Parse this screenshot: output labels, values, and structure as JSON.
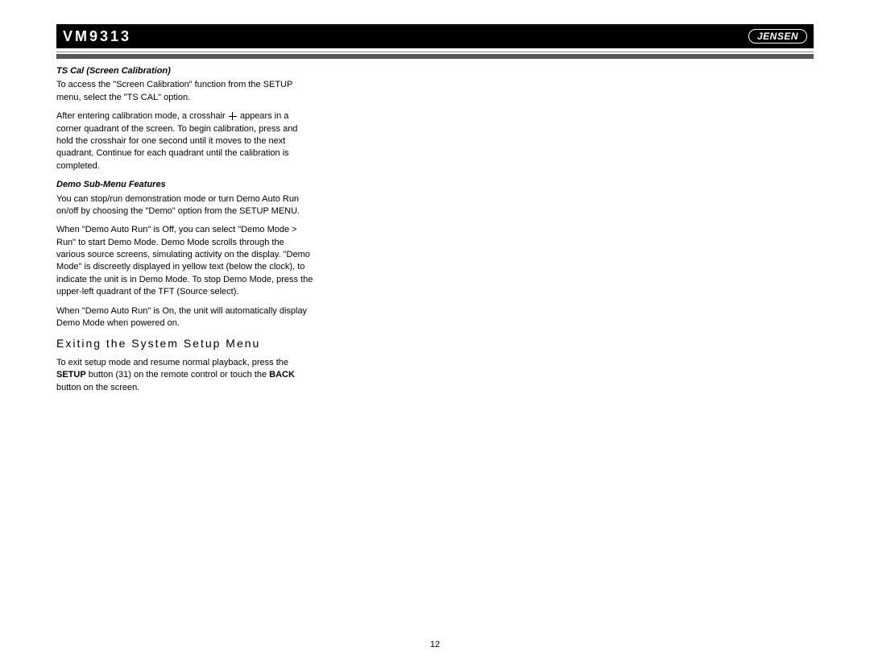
{
  "header": {
    "model": "VM9313",
    "brand": "JENSEN"
  },
  "content": {
    "section1": {
      "title": "TS Cal (Screen Calibration)",
      "p1": "To access the \"Screen Calibration\" function from the SETUP menu, select the \"TS CAL\" option.",
      "p2a": "After entering calibration mode, a crosshair ",
      "p2b": " appears in a corner quadrant of the screen. To begin calibration, press and hold the crosshair for one second until it moves to the next quadrant. Continue for each quadrant until the calibration is completed."
    },
    "section2": {
      "title": "Demo Sub-Menu Features",
      "p1": "You can stop/run demonstration mode or turn Demo Auto Run on/off by choosing the \"Demo\" option from the SETUP MENU.",
      "p2": "When \"Demo Auto Run\" is Off, you can select \"Demo Mode > Run\" to start Demo Mode. Demo Mode scrolls through the various source screens, simulating activity on the display. \"Demo Mode\" is discreetly displayed in yellow text (below the clock), to indicate the unit is in Demo Mode. To stop Demo Mode, press the upper-left quadrant of the TFT (Source select).",
      "p3": "When \"Demo Auto Run\" is On, the unit will automatically display Demo Mode when powered on."
    },
    "section3": {
      "heading": "Exiting the System Setup Menu",
      "p1a": "To exit setup mode and resume normal playback, press the ",
      "p1b": "SETUP",
      "p1c": " button (31) on the remote control or touch the ",
      "p1d": "BACK",
      "p1e": " button on the screen."
    }
  },
  "page_number": "12"
}
